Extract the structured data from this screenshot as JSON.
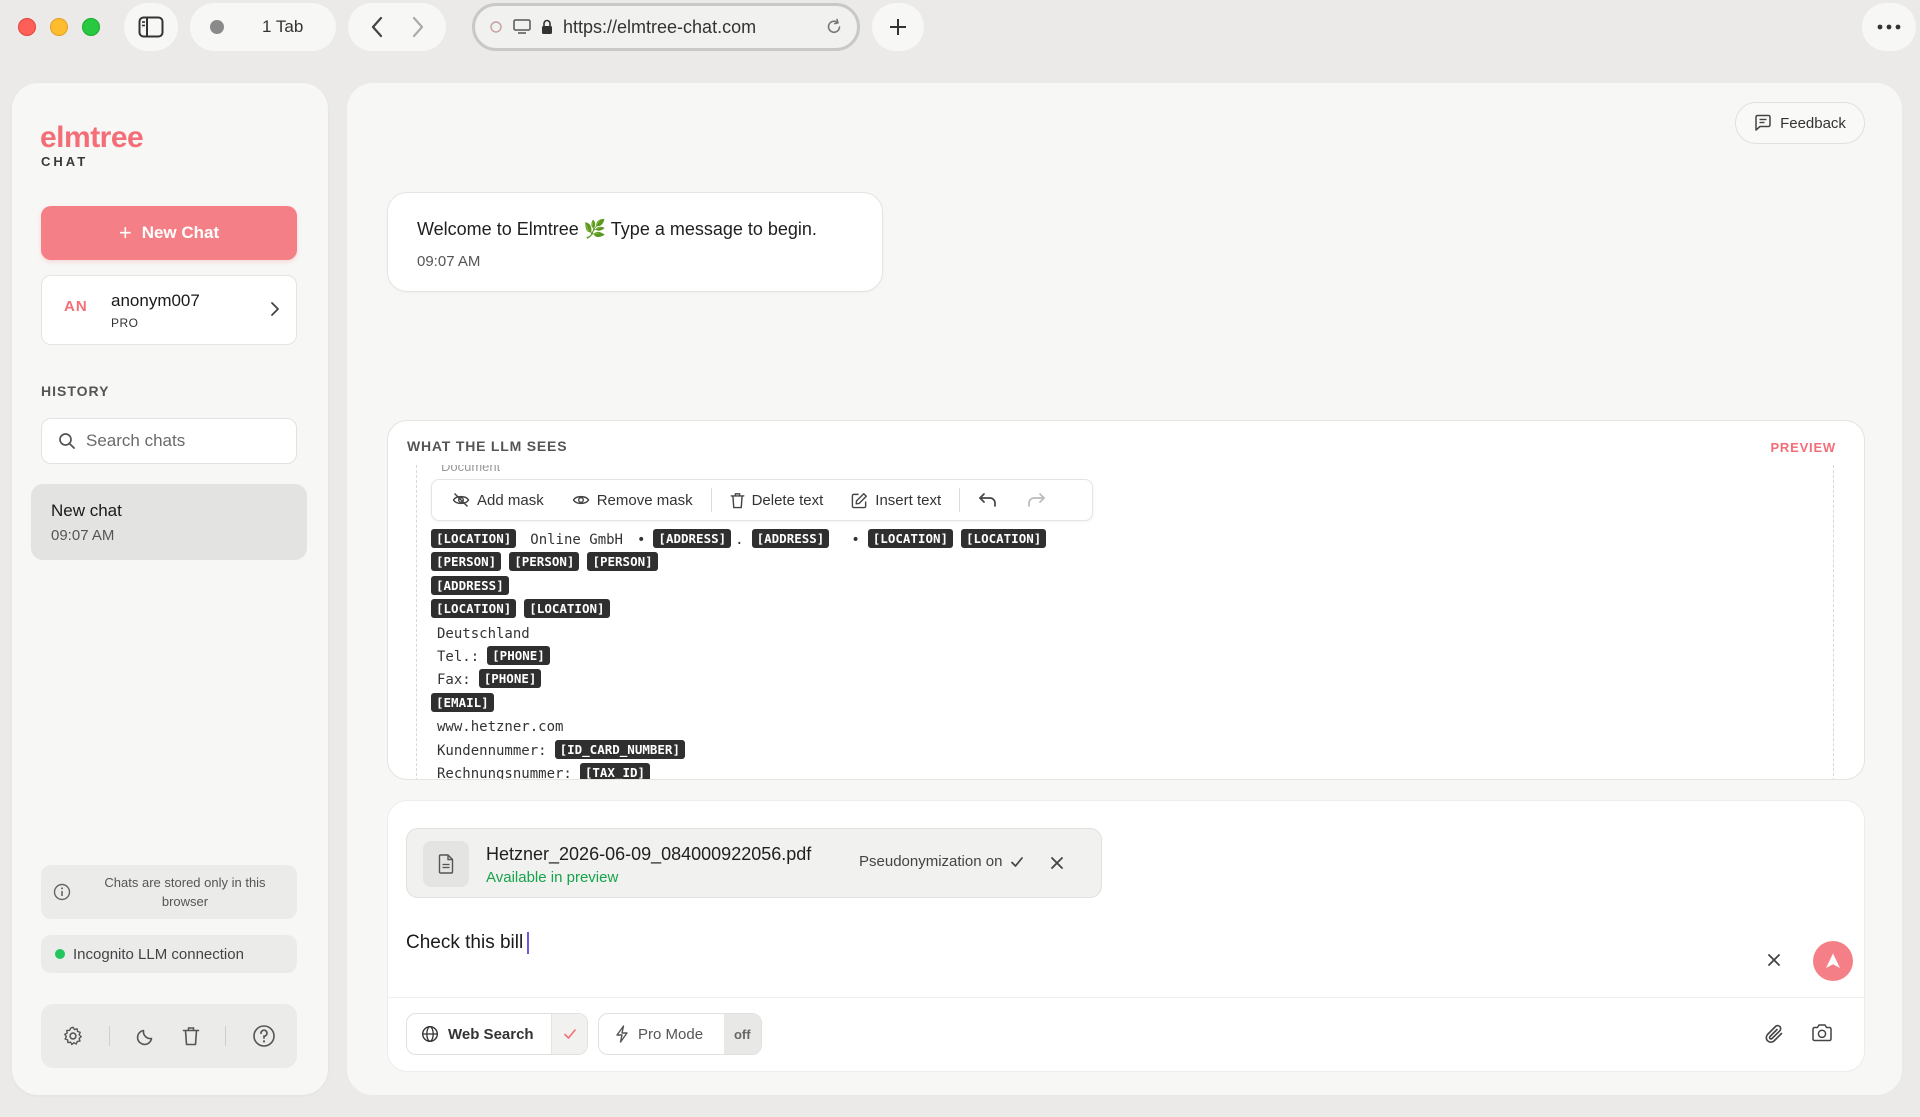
{
  "browser": {
    "tab_label": "1 Tab",
    "url": "https://elmtree-chat.com"
  },
  "sidebar": {
    "logo": "elmtree",
    "logo_sub": "CHAT",
    "new_chat_label": "New Chat",
    "profile": {
      "initials": "AN",
      "name": "anonym007",
      "tier": "PRO"
    },
    "history_label": "HISTORY",
    "search_placeholder": "Search chats",
    "history": [
      {
        "title": "New chat",
        "time": "09:07 AM"
      }
    ],
    "storage_notice": "Chats are stored only in this browser",
    "connection_status": "Incognito LLM connection"
  },
  "main": {
    "feedback_label": "Feedback",
    "welcome": {
      "text": "Welcome to Elmtree 🌿 Type a message to begin.",
      "time": "09:07 AM"
    },
    "preview": {
      "title": "WHAT THE LLM SEES",
      "badge": "PREVIEW",
      "doc_header_clip": "Document",
      "toolbar": {
        "add_mask": "Add mask",
        "remove_mask": "Remove mask",
        "delete_text": "Delete text",
        "insert_text": "Insert text"
      },
      "lines": {
        "l1_a": "[LOCATION]",
        "l1_b": "Online GmbH",
        "l1_c": "•",
        "l1_d": "[ADDRESS]",
        "l1_e": ".",
        "l1_f": "[ADDRESS]",
        "l1_g": "•",
        "l1_h": "[LOCATION]",
        "l1_i": "[LOCATION]",
        "l2_a": "[PERSON]",
        "l2_b": "[PERSON]",
        "l2_c": "[PERSON]",
        "l3_a": "[ADDRESS]",
        "l4_a": "[LOCATION]",
        "l4_b": "[LOCATION]",
        "l5_a": "Deutschland",
        "l6_a": "Tel.:",
        "l6_b": "[PHONE]",
        "l7_a": "Fax:",
        "l7_b": "[PHONE]",
        "l8_a": "[EMAIL]",
        "l9_a": "www.hetzner.com",
        "l10_a": "Kundennummer:",
        "l10_b": "[ID_CARD_NUMBER]",
        "l11_a": "Rechnungsnummer:",
        "l11_b": "[TAX_ID]"
      }
    },
    "composer": {
      "attachment": {
        "file_name": "Hetzner_2026-06-09_084000922056.pdf",
        "status": "Available in preview",
        "pseudonymization": "Pseudonymization on"
      },
      "message": "Check this bill",
      "web_search_label": "Web Search",
      "pro_mode_label": "Pro Mode",
      "pro_mode_state": "off"
    }
  },
  "colors": {
    "accent": "#f46e78",
    "button": "#f47f86",
    "success": "#16a34a",
    "mask_bg": "#2f2f2f"
  }
}
